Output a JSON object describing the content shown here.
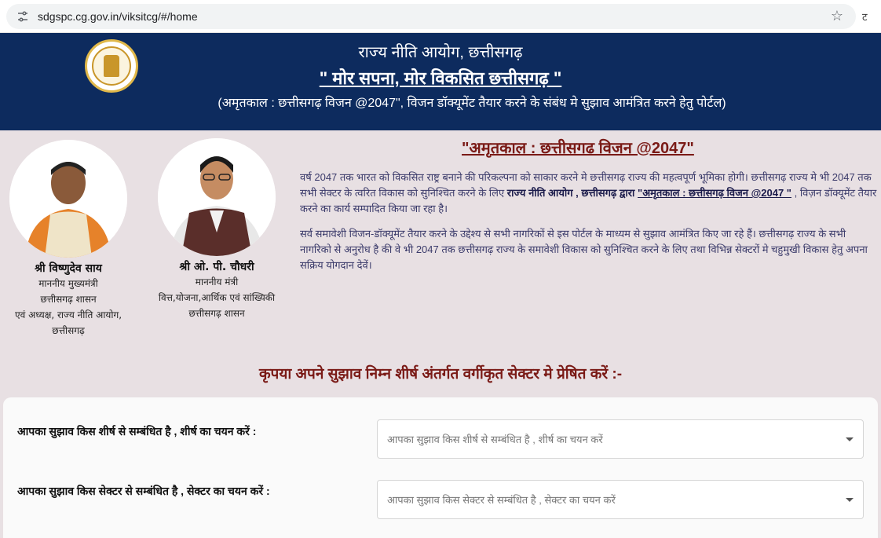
{
  "browser": {
    "url": "sdgspc.cg.gov.in/viksitcg/#/home",
    "ext_label": "ट"
  },
  "header": {
    "title": "राज्य नीति आयोग, छत्तीसगढ़",
    "slogan": "\" मोर सपना, मोर विकसित छत्तीसगढ़ \"",
    "subtitle": "(अमृतकाल : छत्तीसगढ़ विजन @2047\", विजन डॉक्यूमेंट तैयार करने के संबंध मे सुझाव आमंत्रित करने हेतु पोर्टल)"
  },
  "leaders": [
    {
      "name": "श्री विष्णुदेव साय",
      "lines": [
        "माननीय मुख्यमंत्री",
        "छत्तीसगढ़ शासन",
        "एवं अध्यक्ष, राज्य नीति आयोग,",
        "छत्तीसगढ़"
      ]
    },
    {
      "name": "श्री ओ. पी. चौधरी",
      "lines": [
        "माननीय मंत्री",
        "वित्त,योजना,आर्थिक एवं सांख्यिकी",
        "छत्तीसगढ़ शासन"
      ]
    }
  ],
  "main": {
    "heading": "\"अमृतकाल : छत्तीसगढ विजन @2047\"",
    "p1_a": "वर्ष 2047 तक भारत को विकसित राष्ट्र बनाने की परिकल्पना को साकार करने मे छत्तीसगढ़ राज्य की महत्वपूर्ण भूमिका होगी। छत्तीसगढ़ राज्य मे भी 2047 तक सभी सेक्टर के त्वरित विकास को सुनिश्चित करने के लिए ",
    "p1_b": "राज्य नीति आयोग , छत्तीसगढ़ द्वारा ",
    "p1_c": "\"अमृतकाल : छत्तीसगढ़ विजन @2047 \"",
    "p1_d": " , विज़न डॉक्यूमेंट तैयार करने का कार्य सम्पादित किया जा रहा है।",
    "p2": "सर्व समावेशी विजन-डॉक्यूमेंट तैयार करने के उद्देश्य से सभी नागरिकों से इस पोर्टल के माध्यम से सुझाव आमंत्रित किए जा रहे हैं। छत्तीसगढ़ राज्य के सभी नागरिको से अनुरोध है की वे भी 2047 तक छत्तीसगढ़ राज्य के समावेशी विकास को सुनिश्चित करने के लिए तथा विभिन्न सेक्टरों मे चहुमुखी विकास हेतु अपना सक्रिय योगदान देवें।"
  },
  "form": {
    "heading": "कृपया अपने सुझाव निम्न शीर्ष अंतर्गत वर्गीकृत सेक्टर मे प्रेषित करें :-",
    "row1_label": "आपका सुझाव किस शीर्ष से सम्बंधित है , शीर्ष का चयन करें :",
    "row1_placeholder": "आपका सुझाव किस शीर्ष से सम्बंधित है , शीर्ष का चयन करें",
    "row2_label": "आपका सुझाव किस सेक्टर से सम्बंधित है , सेक्टर का चयन करें :",
    "row2_placeholder": "आपका सुझाव किस सेक्टर से सम्बंधित है , सेक्टर का चयन करें"
  }
}
